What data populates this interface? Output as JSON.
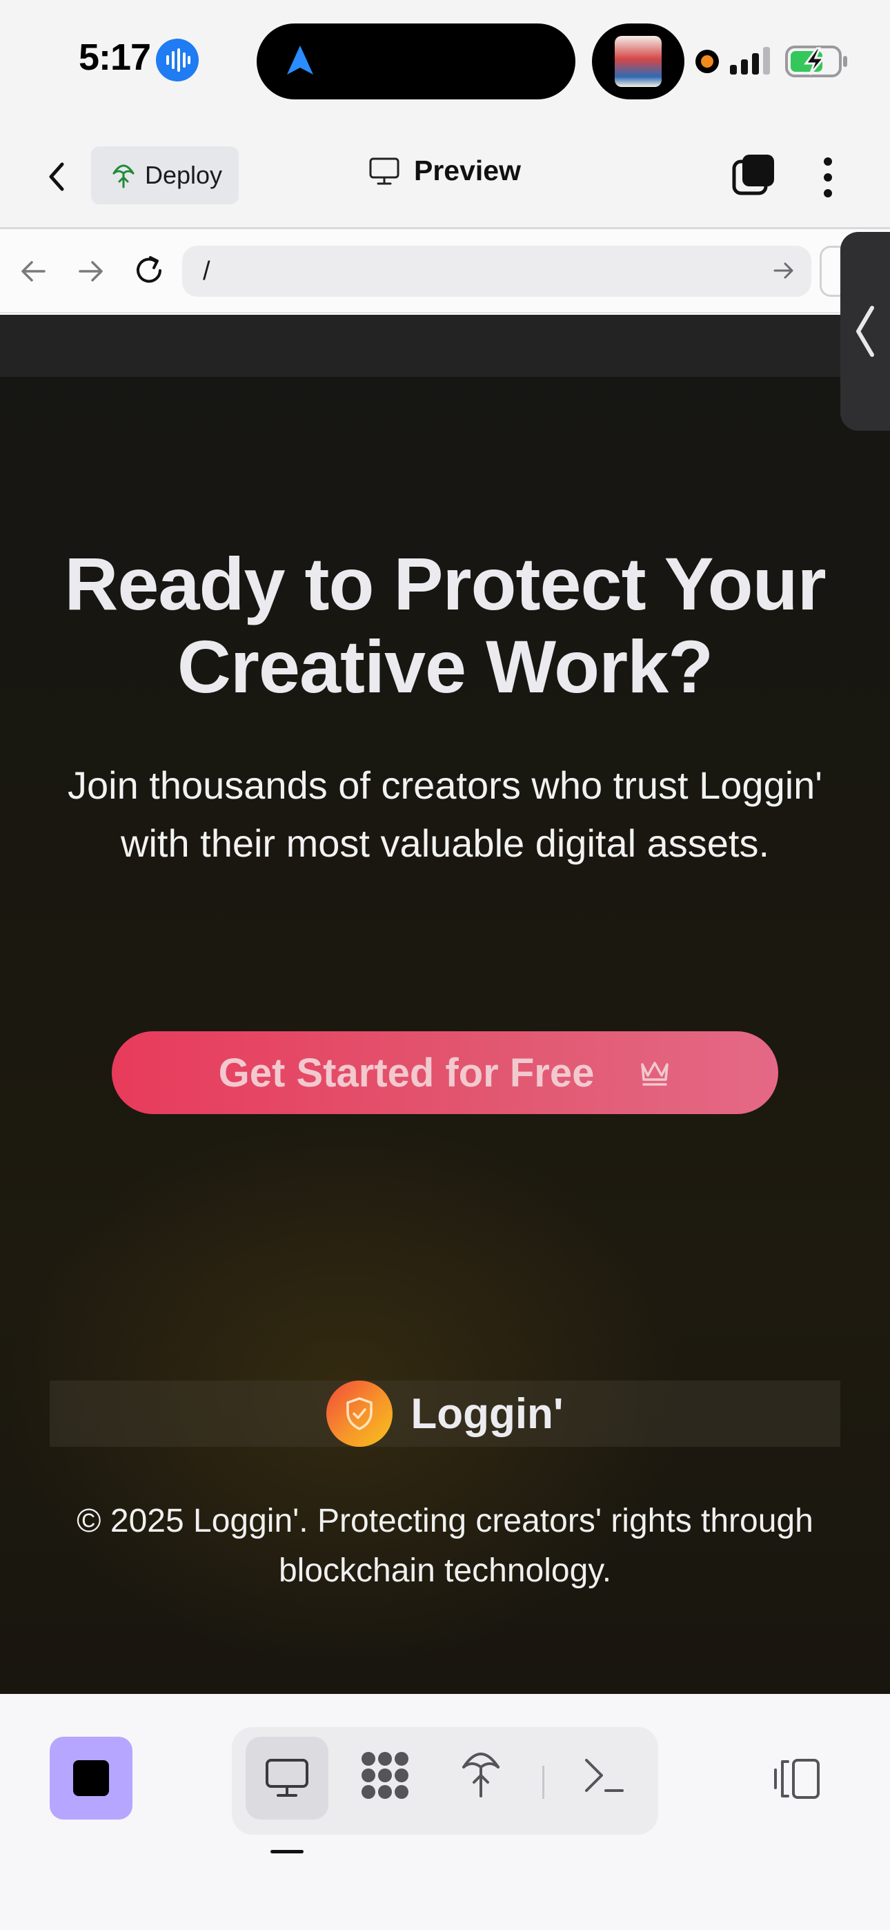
{
  "status_bar": {
    "time": "5:17"
  },
  "header": {
    "deploy_label": "Deploy",
    "title": "Preview"
  },
  "url_bar": {
    "value": "/"
  },
  "page": {
    "heading": "Ready to Protect Your Creative Work?",
    "subheading": "Join thousands of creators who trust Loggin' with their most valuable digital assets.",
    "cta_label": "Get Started for Free",
    "brand_name": "Loggin'",
    "copyright": "© 2025 Loggin'. Protecting creators' rights through blockchain technology."
  },
  "colors": {
    "cta_gradient_start": "#e83b5c",
    "cta_gradient_end": "#e46986",
    "stop_button": "#b7a6ff",
    "page_background": "#19170f"
  },
  "icons": {
    "status": [
      "voice-icon",
      "navigation-arrow-icon",
      "record-dot-icon",
      "signal-icon",
      "battery-charging-icon"
    ],
    "header": [
      "chevron-left-icon",
      "deploy-icon",
      "monitor-icon",
      "tabs-icon",
      "more-vertical-icon"
    ],
    "url": [
      "arrow-left-icon",
      "arrow-right-icon",
      "reload-icon",
      "go-arrow-icon"
    ],
    "toolbar": [
      "stop-icon",
      "monitor-icon",
      "apps-icon",
      "deploy-icon",
      "terminal-icon",
      "split-view-icon"
    ],
    "page": [
      "crown-icon",
      "shield-icon"
    ]
  }
}
